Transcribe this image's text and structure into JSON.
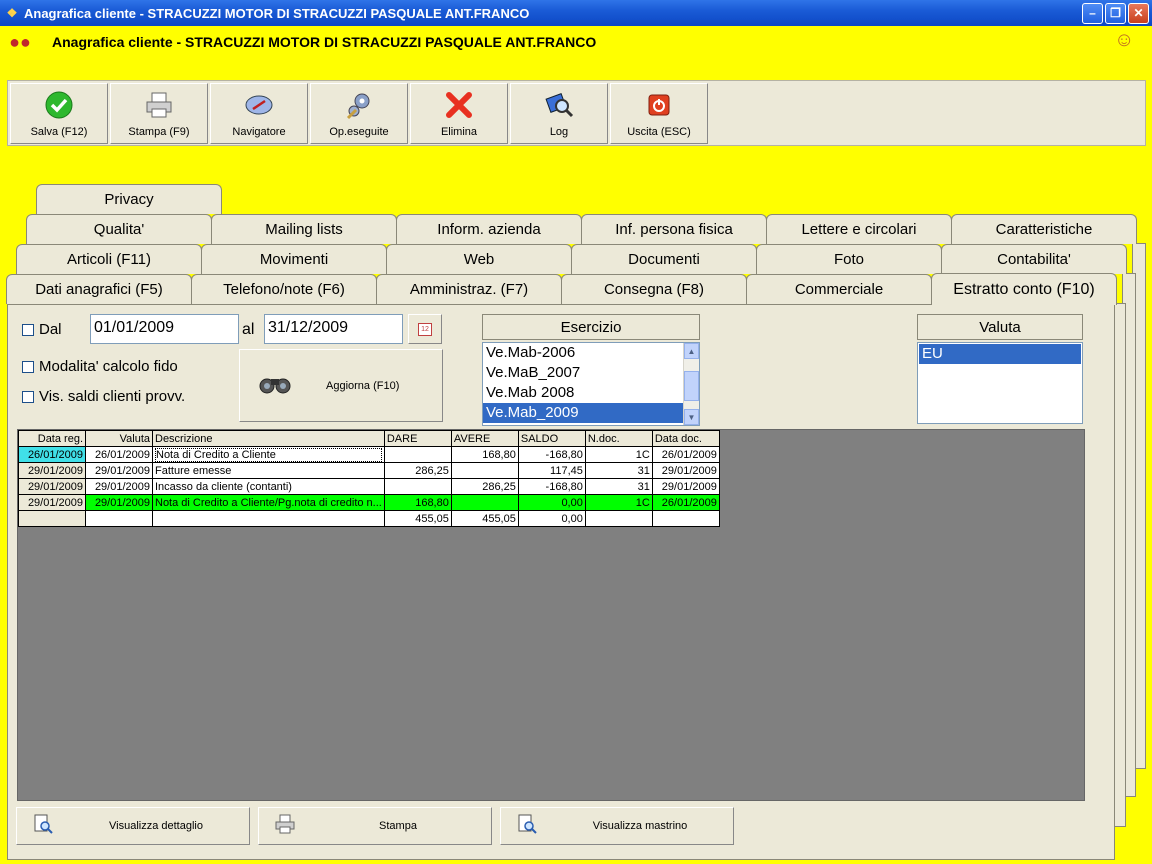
{
  "window": {
    "title": "Anagrafica cliente - STRACUZZI MOTOR DI STRACUZZI PASQUALE ANT.FRANCO"
  },
  "header": {
    "title": "Anagrafica cliente - STRACUZZI MOTOR DI STRACUZZI PASQUALE ANT.FRANCO"
  },
  "toolbar": {
    "buttons": [
      {
        "label": "Salva (F12)",
        "icon": "check-icon"
      },
      {
        "label": "Stampa (F9)",
        "icon": "printer-icon"
      },
      {
        "label": "Navigatore",
        "icon": "compass-icon"
      },
      {
        "label": "Op.eseguite",
        "icon": "gears-icon"
      },
      {
        "label": "Elimina",
        "icon": "delete-x-icon"
      },
      {
        "label": "Log",
        "icon": "log-search-icon"
      },
      {
        "label": "Uscita (ESC)",
        "icon": "power-icon"
      }
    ]
  },
  "tabs": {
    "row1": [
      "Privacy"
    ],
    "row2": [
      "Qualita'",
      "Mailing lists",
      "Inform. azienda",
      "Inf. persona fisica",
      "Lettere e circolari",
      "Caratteristiche"
    ],
    "row3": [
      "Articoli (F11)",
      "Movimenti",
      "Web",
      "Documenti",
      "Foto",
      "Contabilita'"
    ],
    "row4": [
      "Dati anagrafici (F5)",
      "Telefono/note (F6)",
      "Amministraz. (F7)",
      "Consegna (F8)",
      "Commerciale",
      "Estratto conto (F10)"
    ]
  },
  "filters": {
    "dal_label": "Dal",
    "date_from": "01/01/2009",
    "al_label": "al",
    "date_to": "31/12/2009",
    "calendar_badge": "12",
    "modalita_label": "Modalita' calcolo fido",
    "vis_saldi_label": "Vis. saldi clienti provv.",
    "aggiorna_label": "Aggiorna (F10)"
  },
  "esercizio": {
    "header": "Esercizio",
    "items": [
      "Ve.Mab-2006",
      "Ve.MaB_2007",
      "Ve.Mab 2008",
      "Ve.Mab_2009"
    ],
    "selected_index": 3
  },
  "valuta": {
    "header": "Valuta",
    "items": [
      "EU"
    ],
    "selected_index": 0
  },
  "grid": {
    "columns": [
      "Data reg.",
      "Valuta",
      "Descrizione",
      "DARE",
      "AVERE",
      "SALDO",
      "N.doc.",
      "Data doc."
    ],
    "rows": [
      [
        "26/01/2009",
        "26/01/2009",
        "Nota di Credito a Cliente",
        "",
        "168,80",
        "-168,80",
        "1C",
        "26/01/2009"
      ],
      [
        "29/01/2009",
        "29/01/2009",
        "Fatture emesse",
        "286,25",
        "",
        "117,45",
        "31",
        "29/01/2009"
      ],
      [
        "29/01/2009",
        "29/01/2009",
        "Incasso da cliente (contanti)",
        "",
        "286,25",
        "-168,80",
        "31",
        "29/01/2009"
      ],
      [
        "29/01/2009",
        "29/01/2009",
        "Nota di Credito a Cliente/Pg.nota di credito n...",
        "168,80",
        "",
        "0,00",
        "1C",
        "26/01/2009"
      ]
    ],
    "totals": [
      "",
      "",
      "",
      "455,05",
      "455,05",
      "0,00",
      "",
      ""
    ]
  },
  "footer": {
    "buttons": [
      {
        "label": "Visualizza dettaglio",
        "icon": "magnifier-doc-icon"
      },
      {
        "label": "Stampa",
        "icon": "printer-icon"
      },
      {
        "label": "Visualizza mastrino",
        "icon": "magnifier-doc-icon"
      }
    ]
  }
}
